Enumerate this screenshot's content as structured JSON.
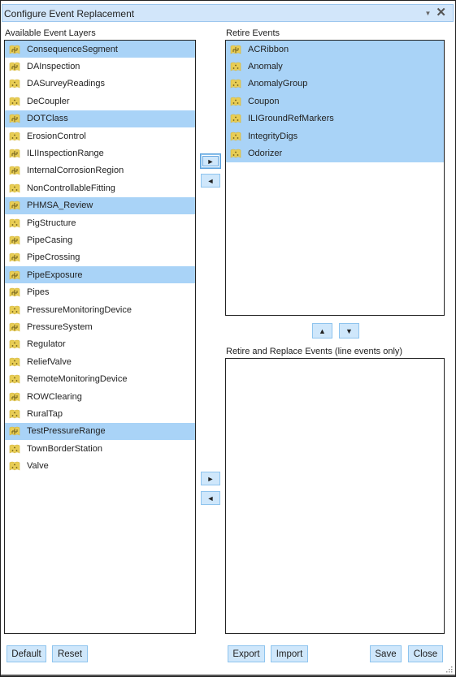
{
  "dialog": {
    "title": "Configure Event Replacement",
    "minimize_icon": "caret-down-icon",
    "close_icon": "close-x-icon"
  },
  "available": {
    "label": "Available Event Layers",
    "items": [
      {
        "label": "ConsequenceSegment",
        "icon": "line",
        "selected": true
      },
      {
        "label": "DAInspection",
        "icon": "line",
        "selected": false
      },
      {
        "label": "DASurveyReadings",
        "icon": "point",
        "selected": false
      },
      {
        "label": "DeCoupler",
        "icon": "point",
        "selected": false
      },
      {
        "label": "DOTClass",
        "icon": "line",
        "selected": true
      },
      {
        "label": "ErosionControl",
        "icon": "point",
        "selected": false
      },
      {
        "label": "ILIInspectionRange",
        "icon": "line",
        "selected": false
      },
      {
        "label": "InternalCorrosionRegion",
        "icon": "line",
        "selected": false
      },
      {
        "label": "NonControllableFitting",
        "icon": "point",
        "selected": false
      },
      {
        "label": "PHMSA_Review",
        "icon": "line",
        "selected": true
      },
      {
        "label": "PigStructure",
        "icon": "point",
        "selected": false
      },
      {
        "label": "PipeCasing",
        "icon": "line",
        "selected": false
      },
      {
        "label": "PipeCrossing",
        "icon": "line",
        "selected": false
      },
      {
        "label": "PipeExposure",
        "icon": "line",
        "selected": true
      },
      {
        "label": "Pipes",
        "icon": "line",
        "selected": false
      },
      {
        "label": "PressureMonitoringDevice",
        "icon": "point",
        "selected": false
      },
      {
        "label": "PressureSystem",
        "icon": "line",
        "selected": false
      },
      {
        "label": "Regulator",
        "icon": "point",
        "selected": false
      },
      {
        "label": "ReliefValve",
        "icon": "point",
        "selected": false
      },
      {
        "label": "RemoteMonitoringDevice",
        "icon": "point",
        "selected": false
      },
      {
        "label": "ROWClearing",
        "icon": "line",
        "selected": false
      },
      {
        "label": "RuralTap",
        "icon": "point",
        "selected": false
      },
      {
        "label": "TestPressureRange",
        "icon": "line",
        "selected": true
      },
      {
        "label": "TownBorderStation",
        "icon": "point",
        "selected": false
      },
      {
        "label": "Valve",
        "icon": "point",
        "selected": false
      }
    ]
  },
  "retire": {
    "label": "Retire Events",
    "items": [
      {
        "label": "ACRibbon",
        "icon": "line",
        "selected": true
      },
      {
        "label": "Anomaly",
        "icon": "point",
        "selected": true
      },
      {
        "label": "AnomalyGroup",
        "icon": "point",
        "selected": true
      },
      {
        "label": "Coupon",
        "icon": "point",
        "selected": true
      },
      {
        "label": "ILIGroundRefMarkers",
        "icon": "point",
        "selected": true
      },
      {
        "label": "IntegrityDigs",
        "icon": "point",
        "selected": true
      },
      {
        "label": "Odorizer",
        "icon": "point",
        "selected": true
      }
    ]
  },
  "replace": {
    "label": "Retire and Replace Events (line events only)",
    "items": []
  },
  "arrows": {
    "right": "►",
    "left": "◄",
    "up": "▲",
    "down": "▼"
  },
  "footer": {
    "default": "Default",
    "reset": "Reset",
    "export": "Export",
    "import": "Import",
    "save": "Save",
    "close": "Close"
  },
  "colors": {
    "selection": "#a9d3f7",
    "button_bg": "#cfe7fb",
    "titlebar_bg": "#d2e6fa",
    "icon_yellow": "#e8cd55"
  }
}
